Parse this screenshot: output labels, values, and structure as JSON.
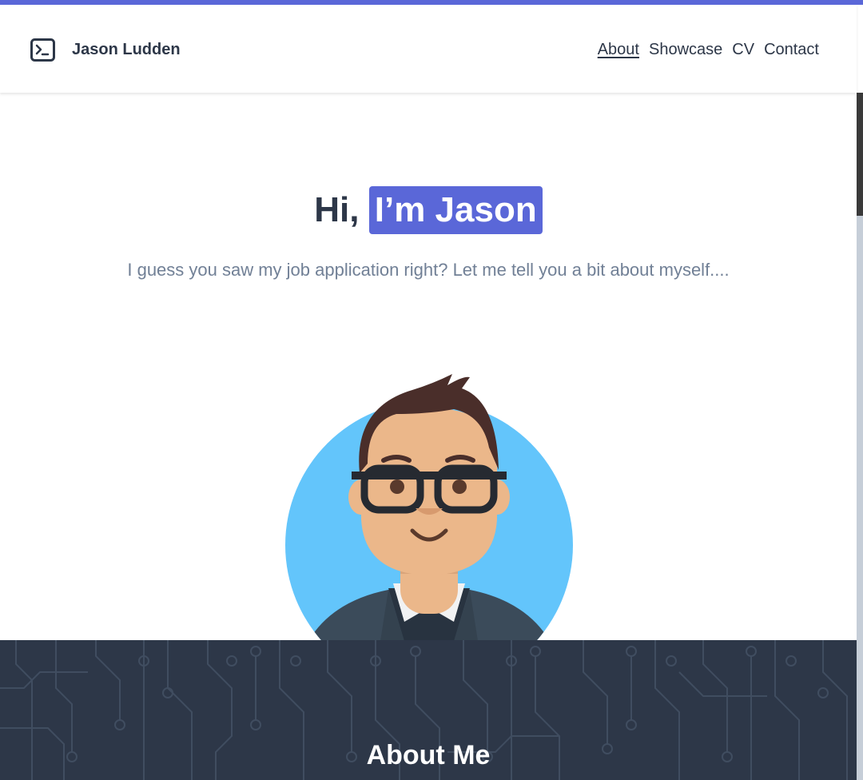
{
  "brand": {
    "name": "Jason Ludden",
    "icon": "terminal-icon"
  },
  "nav": {
    "items": [
      "About",
      "Showcase",
      "CV",
      "Contact"
    ],
    "active": "About"
  },
  "hero": {
    "greeting": "Hi,",
    "highlight": "I’m Jason",
    "subtitle": "I guess you saw my job application right? Let me tell you a bit about myself...."
  },
  "about": {
    "title": "About Me"
  },
  "colors": {
    "accent": "#5a67d8",
    "dark": "#2d3748",
    "muted": "#718096",
    "avatar_bg": "#63c5fb"
  }
}
